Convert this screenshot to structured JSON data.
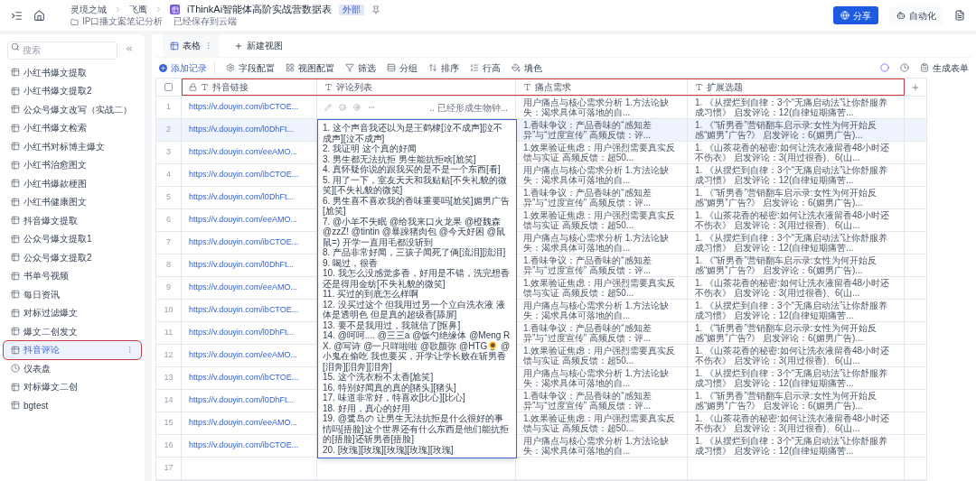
{
  "top_bar": {
    "breadcrumb": [
      "灵境之城",
      "飞鹰"
    ],
    "doc_title": "iThinkAi智能体高阶实战营数据表",
    "badge": "外部",
    "folder": "IP口播文案笔记分析",
    "save_status": "已经保存到云端",
    "buttons": [
      {
        "label": "分享",
        "kind": "primary"
      },
      {
        "label": "自动化",
        "kind": "secondary"
      }
    ]
  },
  "sidebar": {
    "search_placeholder": "搜索",
    "items": [
      {
        "label": "小红书爆文提取",
        "kind": "table",
        "selected": false,
        "outlined": false
      },
      {
        "label": "小红书爆文提取2",
        "kind": "table",
        "selected": false,
        "outlined": false
      },
      {
        "label": "公众号爆文改写（实战二）",
        "kind": "table",
        "selected": false,
        "outlined": false
      },
      {
        "label": "小红书爆文检索",
        "kind": "table",
        "selected": false,
        "outlined": false
      },
      {
        "label": "小红书对标博主爆文",
        "kind": "table",
        "selected": false,
        "outlined": false
      },
      {
        "label": "小红书治愈图文",
        "kind": "table",
        "selected": false,
        "outlined": false
      },
      {
        "label": "小红书爆款梗图",
        "kind": "table",
        "selected": false,
        "outlined": false
      },
      {
        "label": "小红书健康图文",
        "kind": "table",
        "selected": false,
        "outlined": false
      },
      {
        "label": "抖音爆文提取",
        "kind": "table",
        "selected": false,
        "outlined": false
      },
      {
        "label": "公众号爆文提取1",
        "kind": "table",
        "selected": false,
        "outlined": false
      },
      {
        "label": "公众号爆文提取2",
        "kind": "table",
        "selected": false,
        "outlined": false
      },
      {
        "label": "书单号视频",
        "kind": "table",
        "selected": false,
        "outlined": false
      },
      {
        "label": "每日资讯",
        "kind": "table",
        "selected": false,
        "outlined": false
      },
      {
        "label": "对标过滤爆文",
        "kind": "table",
        "selected": false,
        "outlined": false
      },
      {
        "label": "爆文二创发文",
        "kind": "table",
        "selected": false,
        "outlined": false
      },
      {
        "label": "抖音评论",
        "kind": "table",
        "selected": true,
        "outlined": true
      },
      {
        "label": "仪表盘",
        "kind": "dashboard",
        "selected": false,
        "outlined": false
      },
      {
        "label": "对标爆文二创",
        "kind": "table",
        "selected": false,
        "outlined": false
      },
      {
        "label": "bgtest",
        "kind": "table",
        "selected": false,
        "outlined": false
      }
    ]
  },
  "view_tabs": [
    {
      "label": "表格",
      "selected": true
    }
  ],
  "new_view": "新建视图",
  "toolbar": {
    "add_record": "添加记录",
    "tools": [
      {
        "label": "字段配置",
        "kind": "settings"
      },
      {
        "label": "视图配置",
        "kind": "view"
      },
      {
        "label": "筛选",
        "kind": "filter"
      },
      {
        "label": "分组",
        "kind": "group"
      },
      {
        "label": "排序",
        "kind": "sort"
      },
      {
        "label": "行高",
        "kind": "height"
      },
      {
        "label": "填色",
        "kind": "color"
      }
    ],
    "generate_form": "生成表单"
  },
  "table": {
    "header_outlined": true,
    "select_all_checked": false,
    "columns": [
      {
        "label": "抖音链接",
        "locked": true
      },
      {
        "label": "评论列表",
        "locked": false
      },
      {
        "label": "痛点需求",
        "locked": false
      },
      {
        "label": "扩展选题",
        "locked": false
      }
    ],
    "rows": [
      {
        "number": "1",
        "selected": false,
        "link": "https://v.douyin.com/ibCTOE...",
        "comments": ".. 已经形成生物钟...",
        "pain_points": "用户痛点与核心需求分析 1.方法论缺失：渴求具体可落地的自...",
        "topics": "1. 《从摆烂到自律：3个“无痛启动法”让你舒服养成习惯》 启发评论：12(自律短期痛苦..."
      },
      {
        "number": "2",
        "selected": true,
        "link": "https://v.douyin.com/l0DhFt...",
        "pain_points": "1.香味争议：产品香味的“感知差异”与“过度宣传” 高频反馈：评...",
        "topics": "1. 《“斩男香”营销翻车启示录:女性为何开始反感“媚男”广告?》 启发评论：6(媚男广告)..."
      },
      {
        "number": "3",
        "selected": false,
        "link": "https://v.douyin.com/eeAMO...",
        "pain_points": "1.效果验证焦虑：用户强烈需要真实反馈与实证 高频反馈：超50...",
        "topics": "1. 《山茶花香的秘密:如何让洗衣液留香48小时还不伤衣》 启发评论：3(用过很香)、6(山..."
      },
      {
        "number": "4",
        "selected": false,
        "link": "https://v.douyin.com/ibCTOE...",
        "pain_points": "用户痛点与核心需求分析 1.方法论缺失：渴求具体可落地的自...",
        "topics": "1. 《从摆烂到自律：3个“无痛启动法”让你舒服养成习惯》 启发评论：12(自律短期痛苦..."
      },
      {
        "number": "5",
        "selected": false,
        "link": "https://v.douyin.com/l0DhFt...",
        "pain_points": "1.香味争议：产品香味的“感知差异”与“过度宣传” 高频反馈：评...",
        "topics": "1. 《“斩男香”营销翻车启示录:女性为何开始反感“媚男”广告?》 启发评论：6(媚男广告)..."
      },
      {
        "number": "6",
        "selected": false,
        "link": "https://v.douyin.com/eeAMO...",
        "pain_points": "1.效果验证焦虑：用户强烈需要真实反馈与实证 高频反馈：超50...",
        "topics": "1. 《山茶花香的秘密:如何让洗衣液留香48小时还不伤衣》 启发评论：3(用过很香)、6(山..."
      },
      {
        "number": "7",
        "selected": false,
        "link": "https://v.douyin.com/ibCTOE...",
        "pain_points": "用户痛点与核心需求分析 1.方法论缺失：渴求具体可落地的自...",
        "topics": "1. 《从摆烂到自律：3个“无痛启动法”让你舒服养成习惯》 启发评论：12(自律短期痛苦..."
      },
      {
        "number": "8",
        "selected": false,
        "link": "https://v.douyin.com/l0DhFt...",
        "pain_points": "1.香味争议：产品香味的“感知差异”与“过度宣传” 高频反馈：评...",
        "topics": "1. 《“斩男香”营销翻车启示录:女性为何开始反感“媚男”广告?》 启发评论：6(媚男广告)..."
      },
      {
        "number": "9",
        "selected": false,
        "link": "https://v.douyin.com/eeAMO...",
        "pain_points": "1.效果验证焦虑：用户强烈需要真实反馈与实证 高频反馈：超50...",
        "topics": "1. 《山茶花香的秘密:如何让洗衣液留香48小时还不伤衣》 启发评论：3(用过很香)、6(山..."
      },
      {
        "number": "10",
        "selected": false,
        "link": "https://v.douyin.com/ibCTOE...",
        "pain_points": "用户痛点与核心需求分析 1.方法论缺失：渴求具体可落地的自...",
        "topics": "1. 《从摆烂到自律：3个“无痛启动法”让你舒服养成习惯》 启发评论：12(自律短期痛苦..."
      },
      {
        "number": "11",
        "selected": false,
        "link": "https://v.douyin.com/l0DhFt...",
        "pain_points": "1.香味争议：产品香味的“感知差异”与“过度宣传” 高频反馈：评...",
        "topics": "1. 《“斩男香”营销翻车启示录:女性为何开始反感“媚男”广告?》 启发评论：6(媚男广告)..."
      },
      {
        "number": "12",
        "selected": false,
        "link": "https://v.douyin.com/eeAMO...",
        "pain_points": "1.效果验证焦虑：用户强烈需要真实反馈与实证 高频反馈：超50...",
        "topics": "1. 《山茶花香的秘密:如何让洗衣液留香48小时还不伤衣》 启发评论：3(用过很香)、6(山..."
      },
      {
        "number": "13",
        "selected": false,
        "link": "https://v.douyin.com/ibCTOE...",
        "pain_points": "用户痛点与核心需求分析 1.方法论缺失：渴求具体可落地的自...",
        "topics": "1. 《从摆烂到自律：3个“无痛启动法”让你舒服养成习惯》 启发评论：12(自律短期痛苦..."
      },
      {
        "number": "14",
        "selected": false,
        "link": "https://v.douyin.com/l0DhFt...",
        "pain_points": "1.香味争议：产品香味的“感知差异”与“过度宣传” 高频反馈：评...",
        "topics": "1. 《“斩男香”营销翻车启示录:女性为何开始反感“媚男”广告?》 启发评论：6(媚男广告)..."
      },
      {
        "number": "15",
        "selected": false,
        "link": "https://v.douyin.com/eeAMO...",
        "pain_points": "1.效果验证焦虑：用户强烈需要真实反馈与实证 高频反馈：超50...",
        "topics": "1. 《山茶花香的秘密:如何让洗衣液留香48小时还不伤衣》 启发评论：3(用过很香)、6(山..."
      },
      {
        "number": "16",
        "selected": false,
        "link": "https://v.douyin.com/ibCTOE...",
        "pain_points": "用户痛点与核心需求分析 1.方法论缺失：渴求具体可落地的自...",
        "topics": "1. 《从摆烂到自律：3个“无痛启动法”让你舒服养成习惯》 启发评论：12(自律短期痛苦..."
      },
      {
        "number": "17",
        "selected": false
      }
    ],
    "expanded_cell": {
      "lines": [
        "1. 这个声音我还以为是王鹤棣[泣不成声][泣不成声][泣不成声]",
        "2. 我证明 这个真的好闻",
        "3. 男生都无法抗拒 男生能抗拒啥[尬笑]",
        "4. 真怀疑你说的跟我买的是不是一个东西[看]",
        "5. 用了一下，室友天天和我贴贴[不失礼貌的微笑][不失礼貌的微笑]",
        "6. 男生喜不喜欢我的香味重要吗[尬笑]媚男广告[尬笑]",
        "7. @小羊不失眠 @给我来口火龙果 @橙魏森 @zzZ! @tintin @暴躁猪肉包 @今天好困 @鼠鼠=) 开学一直用毛都没斩到",
        "8. 产品非常好闻，三孩子闻死了俩[流泪][流泪]",
        "9. 喝过，很香",
        "10. 我怎么没感觉多香，好用是不错，洗完想香还是得用金纺[不失礼貌的微笑]",
        "11. 买过的到底怎么样啊",
        "12. 没买过这个 但我用过另一个立白洗衣液 液体是透明色 但是真的超级香[舔屏]",
        "13. 要不是我用过，我就信了[抠鼻]",
        "14. @呵呵.... @三三a @饭勺绝缘体 @Meng RX. @写诗 @一只咩啦啦 @歌颜弥 @HTG🌻 @小鬼在偷吃 我也要买，开学让学长败在斩男香[泪奔][泪奔][泪奔]",
        "15. 这个洗衣粉不太香[尬笑]",
        "16. 特别好闻真的真的[猪头][猪头]",
        "17. 味道非常好，特喜欢[比心][比心]",
        "18. 好用，真心的好用",
        "19. @鹭岛の 让男生无法抗拒是什么很好的事情吗[捂脸]这个世界还有什么东西是他们能抗拒的[捂脸]还斩男香[捂脸]",
        "20. [玫瑰][玫瑰][玫瑰][玫瑰][玫瑰]"
      ]
    }
  }
}
